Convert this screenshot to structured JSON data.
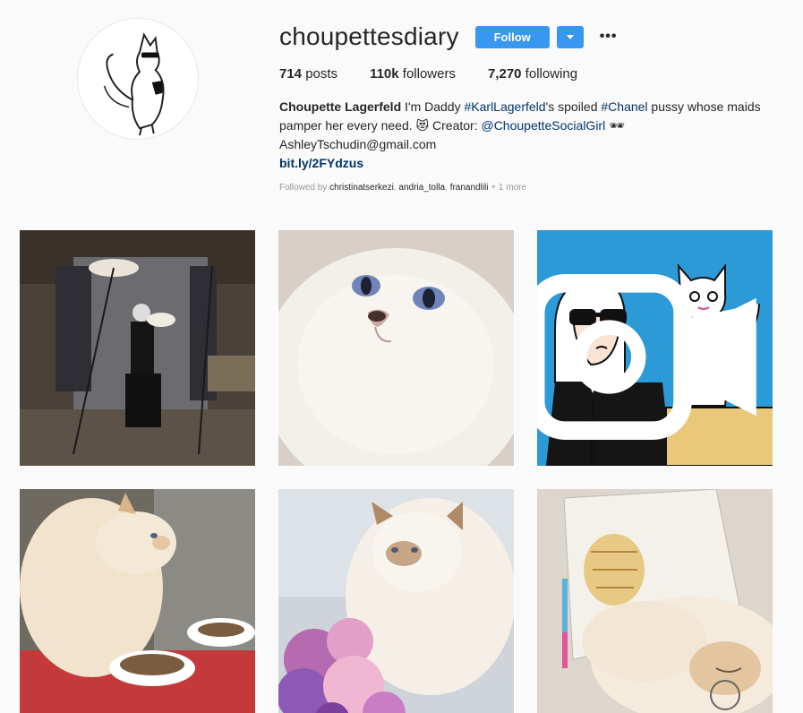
{
  "profile": {
    "username": "choupettesdiary",
    "follow_label": "Follow",
    "more_label": "•••",
    "stats": {
      "posts_count": "714",
      "posts_label": " posts",
      "followers_count": "110k",
      "followers_label": " followers",
      "following_count": "7,270",
      "following_label": " following"
    },
    "bio": {
      "name": "Choupette Lagerfeld",
      "text1": " I'm Daddy ",
      "tag1": "#KarlLagerfeld",
      "text2": "'s spoiled ",
      "tag2": "#Chanel",
      "text3": " pussy whose maids pamper her every need. 😻 Creator: ",
      "mention": "@ChoupetteSocialGirl",
      "text4": " 🕶",
      "email": "AshleyTschudin@gmail.com",
      "link": "bit.ly/2FYdzus"
    },
    "followed_by": {
      "prefix": "Followed by ",
      "user1": "christinatserkezi",
      "sep1": ", ",
      "user2": "andria_tolla",
      "sep2": ", ",
      "user3": "franandlili",
      "suffix": " + 1 more"
    }
  },
  "posts": [
    {
      "name": "post-photoshoot",
      "kind": "photo"
    },
    {
      "name": "post-cat-closeup",
      "kind": "photo"
    },
    {
      "name": "post-illustration",
      "kind": "video",
      "icon": "video-camera-icon"
    },
    {
      "name": "post-cat-eating",
      "kind": "photo"
    },
    {
      "name": "post-cat-flowers",
      "kind": "photo"
    },
    {
      "name": "post-cat-sleeping",
      "kind": "photo"
    }
  ],
  "colors": {
    "accent": "#3897f0",
    "link": "#003569",
    "background": "#fafafa",
    "illustration_blue": "#2b9ad6"
  }
}
